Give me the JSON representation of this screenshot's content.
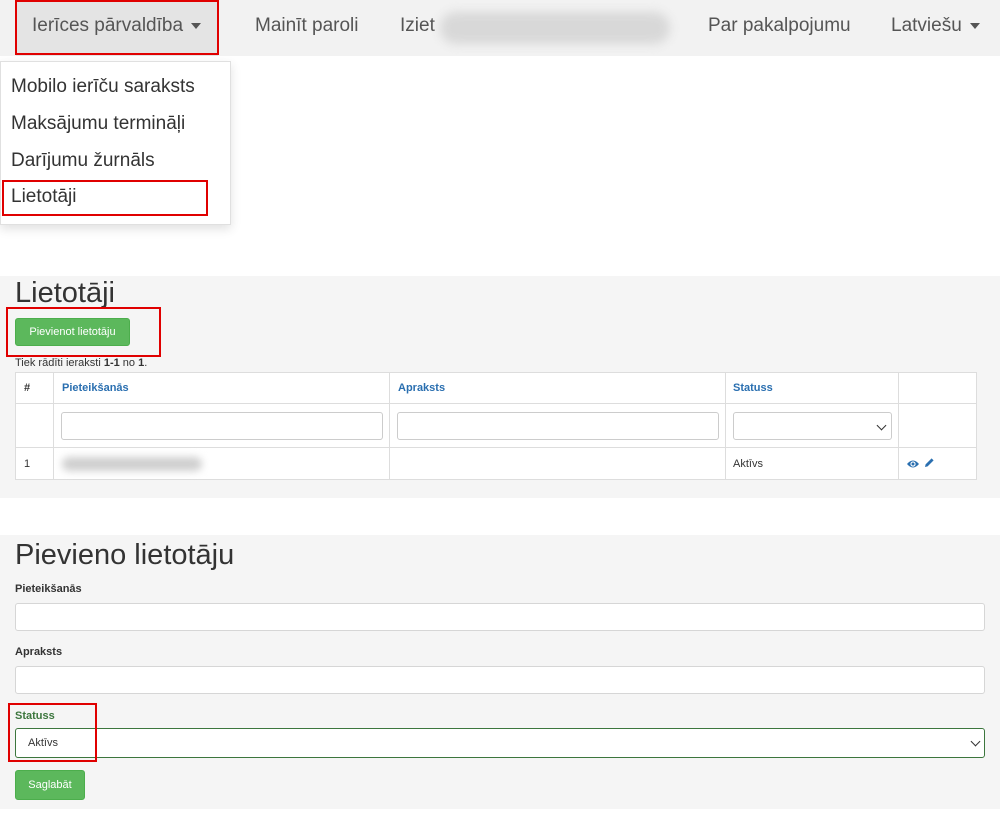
{
  "navbar": {
    "device_menu_label": "Ierīces pārvaldība",
    "change_password_label": "Mainīt paroli",
    "logout_label": "Iziet",
    "about_label": "Par pakalpojumu",
    "language_label": "Latviešu"
  },
  "dropdown": {
    "items": [
      "Mobilo ierīču saraksts",
      "Maksājumu termināļi",
      "Darījumu žurnāls",
      "Lietotāji"
    ]
  },
  "users_list": {
    "title": "Lietotāji",
    "add_button_label": "Pievienot lietotāju",
    "summary_prefix": "Tiek rādīti ieraksti ",
    "summary_range": "1-1",
    "summary_mid": " no ",
    "summary_total": "1",
    "summary_suffix": ".",
    "columns": {
      "num": "#",
      "login": "Pieteikšanās",
      "description": "Apraksts",
      "status": "Statuss"
    },
    "rows": [
      {
        "num": "1",
        "status": "Aktīvs"
      }
    ]
  },
  "add_user_form": {
    "title": "Pievieno lietotāju",
    "login_label": "Pieteikšanās",
    "description_label": "Apraksts",
    "status_label": "Statuss",
    "status_value": "Aktīvs",
    "save_label": "Saglabāt"
  },
  "colors": {
    "highlight": "#e00000",
    "success": "#5cb85c",
    "link": "#2a6fb0",
    "valid_label": "#3c763d"
  }
}
